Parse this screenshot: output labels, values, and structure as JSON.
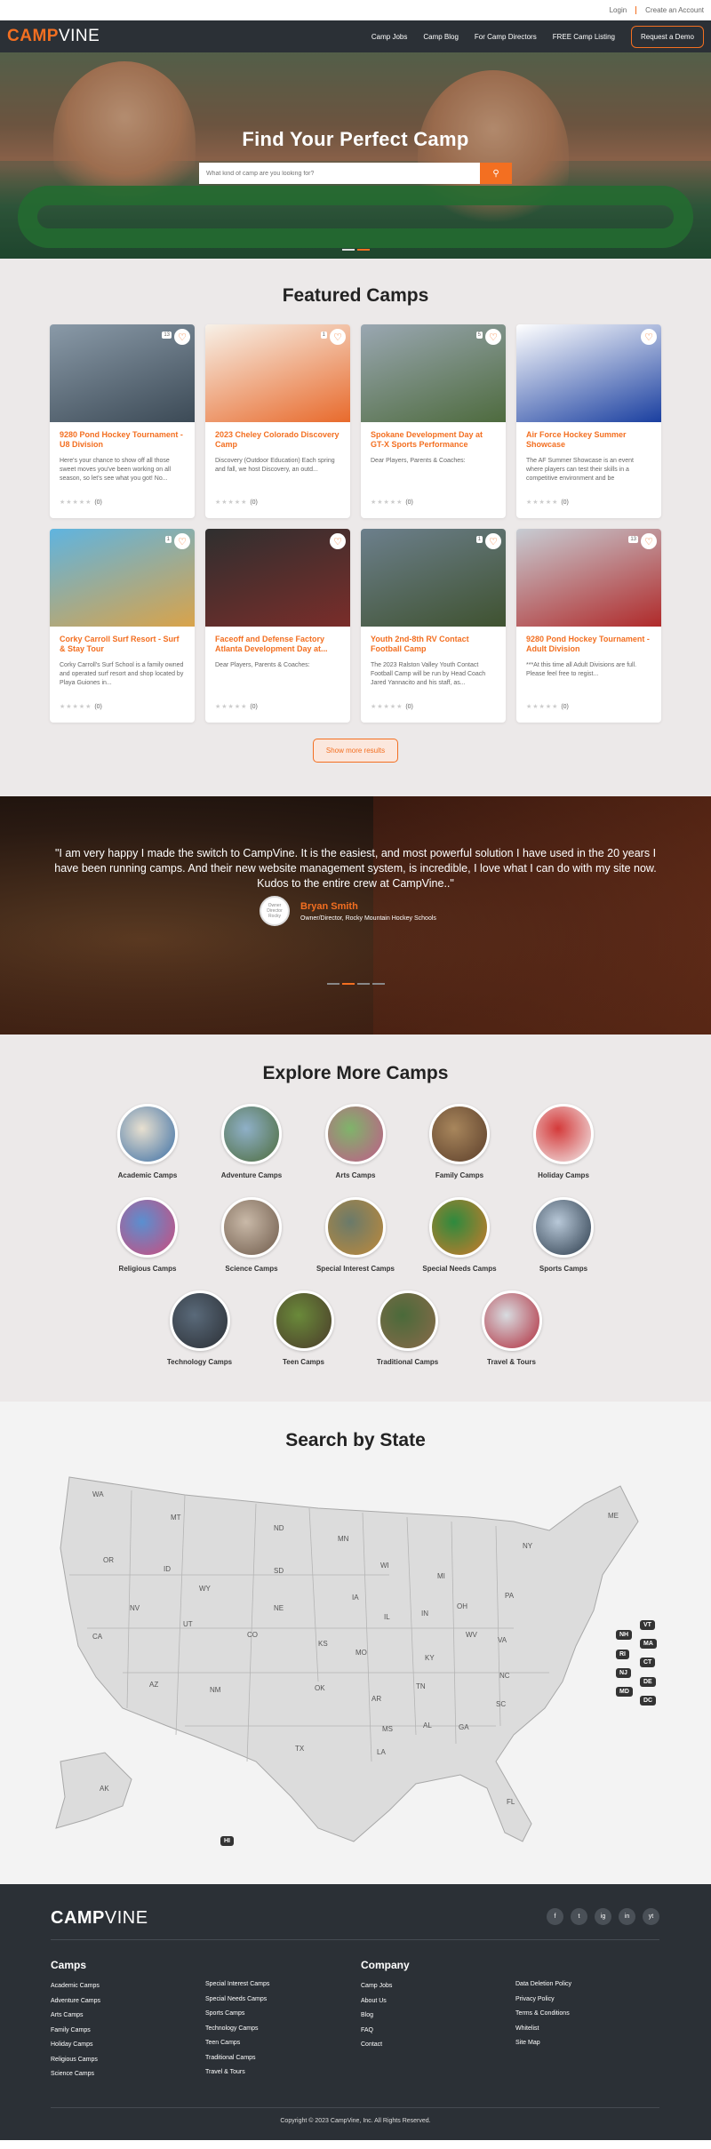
{
  "util": {
    "login": "Login",
    "create": "Create an Account"
  },
  "nav": {
    "logo_a": "CAMP",
    "logo_b": "VINE",
    "links": [
      "Camp Jobs",
      "Camp Blog",
      "For Camp Directors",
      "FREE Camp Listing"
    ],
    "demo": "Request a Demo"
  },
  "hero": {
    "title": "Find Your Perfect Camp",
    "placeholder": "What kind of camp are you looking for?"
  },
  "featured": {
    "title": "Featured Camps",
    "more": "Show more results",
    "cards": [
      {
        "title": "9280 Pond Hockey Tournament - U8 Division",
        "desc": "Here's your chance to show off all those sweet moves you've been working on all season, so let's see what you got! No...",
        "count": "(0)",
        "badge": "13",
        "c1": "#8a9aa8",
        "c2": "#3c4a56"
      },
      {
        "title": "2023 Cheley Colorado Discovery Camp",
        "desc": "Discovery (Outdoor Education) Each spring and fall, we host Discovery, an outd...",
        "count": "(0)",
        "badge": "1",
        "c1": "#f7f1e8",
        "c2": "#e86a2c"
      },
      {
        "title": "Spokane Development Day at GT-X Sports Performance",
        "desc": "Dear Players, Parents & Coaches:",
        "count": "(0)",
        "badge": "5",
        "c1": "#9aa7b2",
        "c2": "#4e6b3e"
      },
      {
        "title": "Air Force Hockey Summer Showcase",
        "desc": "The AF Summer Showcase is an event where players can test their skills in a competitive environment and be",
        "count": "(0)",
        "badge": "",
        "c1": "#ffffff",
        "c2": "#1a3fa0"
      },
      {
        "title": "Corky Carroll Surf Resort - Surf & Stay Tour",
        "desc": "Corky Carroll's Surf School is a family owned and operated surf resort and shop located by Playa Guiones in...",
        "count": "(0)",
        "badge": "1",
        "c1": "#5fb4e0",
        "c2": "#d9a34a"
      },
      {
        "title": "Faceoff and Defense Factory Atlanta Development Day at...",
        "desc": "Dear Players, Parents & Coaches:",
        "count": "(0)",
        "badge": "",
        "c1": "#2f2f2f",
        "c2": "#7a2d2a"
      },
      {
        "title": "Youth 2nd-8th RV Contact Football Camp",
        "desc": "The 2023 Ralston Valley Youth Contact Football Camp will be run by Head Coach Jared Yannacito and his staff, as...",
        "count": "(0)",
        "badge": "1",
        "c1": "#6c7f8c",
        "c2": "#3f5230"
      },
      {
        "title": "9280 Pond Hockey Tournament - Adult Division",
        "desc": "***At this time all Adult Divisions are full. Please feel free to regist...",
        "count": "(0)",
        "badge": "13",
        "c1": "#c7ccd3",
        "c2": "#b02a2a"
      }
    ]
  },
  "testimonial": {
    "quote": "\"I am very happy I made the switch to CampVine. It is the easiest, and most powerful solution I have used in the 20 years I have been running camps. And their new website management system, is incredible, I love what I can do with my site now. Kudos to the entire crew at CampVine..\"",
    "name": "Bryan Smith",
    "role": "Owner/Director, Rocky Mountain Hockey Schools",
    "avatar_text": "Owner Director Rocky"
  },
  "explore": {
    "title": "Explore More Camps",
    "cats": [
      {
        "label": "Academic Camps",
        "c1": "#e8e0d0",
        "c2": "#3a6ea5"
      },
      {
        "label": "Adventure Camps",
        "c1": "#8fb0c8",
        "c2": "#4c6b3a"
      },
      {
        "label": "Arts Camps",
        "c1": "#7fb46a",
        "c2": "#c25a8a"
      },
      {
        "label": "Family Camps",
        "c1": "#a8865c",
        "c2": "#5b3e2a"
      },
      {
        "label": "Holiday Camps",
        "c1": "#d43a3a",
        "c2": "#f2eeee"
      },
      {
        "label": "Religious Camps",
        "c1": "#5a8fd0",
        "c2": "#d04a7a"
      },
      {
        "label": "Science Camps",
        "c1": "#c9b9a8",
        "c2": "#6e5a4a"
      },
      {
        "label": "Special Interest Camps",
        "c1": "#6a7a6a",
        "c2": "#c08a3a"
      },
      {
        "label": "Special Needs Camps",
        "c1": "#2e8a3e",
        "c2": "#d07a2a"
      },
      {
        "label": "Sports Camps",
        "c1": "#b8c8d8",
        "c2": "#2a3a4a"
      },
      {
        "label": "Technology Camps",
        "c1": "#5a6a7a",
        "c2": "#2a2e34"
      },
      {
        "label": "Teen Camps",
        "c1": "#6a8a3a",
        "c2": "#4a3a2a"
      },
      {
        "label": "Traditional Camps",
        "c1": "#4a6a3a",
        "c2": "#8a6a4a"
      },
      {
        "label": "Travel & Tours",
        "c1": "#d8dce0",
        "c2": "#b02a3a"
      }
    ]
  },
  "states": {
    "title": "Search by State",
    "labels": [
      {
        "t": "WA"
      },
      {
        "t": "MT"
      },
      {
        "t": "ND"
      },
      {
        "t": "MN"
      },
      {
        "t": "OR"
      },
      {
        "t": "ID"
      },
      {
        "t": "SD"
      },
      {
        "t": "WI"
      },
      {
        "t": "MI"
      },
      {
        "t": "NY"
      },
      {
        "t": "ME"
      },
      {
        "t": "WY"
      },
      {
        "t": "NE"
      },
      {
        "t": "IA"
      },
      {
        "t": "IL"
      },
      {
        "t": "IN"
      },
      {
        "t": "OH"
      },
      {
        "t": "PA"
      },
      {
        "t": "NV"
      },
      {
        "t": "UT"
      },
      {
        "t": "CO"
      },
      {
        "t": "KS"
      },
      {
        "t": "MO"
      },
      {
        "t": "KY"
      },
      {
        "t": "WV"
      },
      {
        "t": "VA"
      },
      {
        "t": "CA"
      },
      {
        "t": "AZ"
      },
      {
        "t": "NM"
      },
      {
        "t": "OK"
      },
      {
        "t": "AR"
      },
      {
        "t": "TN"
      },
      {
        "t": "NC"
      },
      {
        "t": "SC"
      },
      {
        "t": "MS"
      },
      {
        "t": "AL"
      },
      {
        "t": "GA"
      },
      {
        "t": "TX"
      },
      {
        "t": "LA"
      },
      {
        "t": "FL"
      },
      {
        "t": "AK"
      }
    ],
    "chips": [
      "VT",
      "NH",
      "MA",
      "RI",
      "CT",
      "NJ",
      "DE",
      "MD",
      "DC",
      "HI"
    ]
  },
  "footer": {
    "logo_a": "CAMP",
    "logo_b": "VINE",
    "social": [
      "f",
      "t",
      "ig",
      "in",
      "yt"
    ],
    "camps_title": "Camps",
    "camps_col1": [
      "Academic Camps",
      "Adventure Camps",
      "Arts Camps",
      "Family Camps",
      "Holiday Camps",
      "Religious Camps",
      "Science Camps"
    ],
    "camps_col2": [
      "Special Interest Camps",
      "Special Needs Camps",
      "Sports Camps",
      "Technology Camps",
      "Teen Camps",
      "Traditional Camps",
      "Travel & Tours"
    ],
    "company_title": "Company",
    "company_col1": [
      "Camp Jobs",
      "About Us",
      "Blog",
      "FAQ",
      "Contact"
    ],
    "company_col2": [
      "Data Deletion Policy",
      "Privacy Policy",
      "Terms & Conditions",
      "Whitelist",
      "Site Map"
    ],
    "copyright": "Copyright © 2023 CampVine, Inc. All Rights Reserved."
  }
}
